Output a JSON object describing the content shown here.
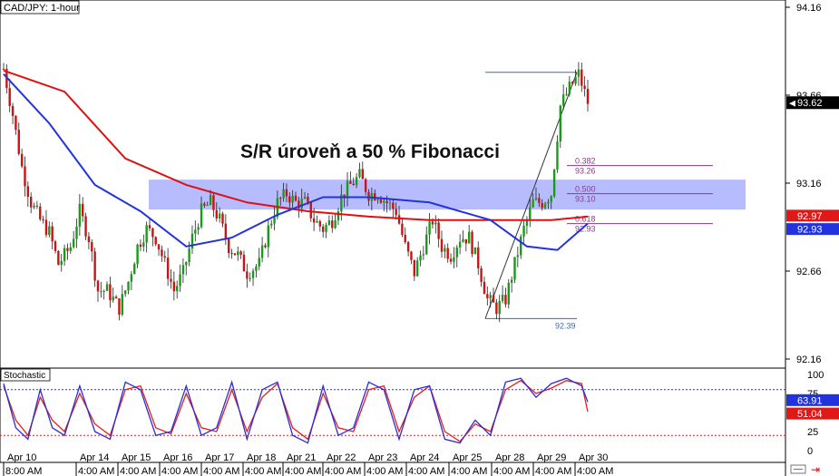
{
  "header": {
    "symbol_label": "CAD/JPY: 1-hour"
  },
  "annotation": {
    "headline": "S/R úroveň a 50 % Fibonacci"
  },
  "price_panel": {
    "y_ticks": [
      "94.16",
      "93.66",
      "93.16",
      "92.66",
      "92.16"
    ],
    "current_price": "93.62",
    "ma_red_value": "92.97",
    "ma_blue_value": "92.93"
  },
  "fibonacci": {
    "high_label": "",
    "low_label": "92.39",
    "levels": [
      {
        "ratio": "0.382",
        "price": "93.26"
      },
      {
        "ratio": "0.500",
        "price": "93.10"
      },
      {
        "ratio": "0.618",
        "price": "92.93"
      }
    ]
  },
  "stochastic": {
    "label": "Stochastic",
    "y_ticks": [
      "100",
      "75",
      "50",
      "25",
      "0"
    ],
    "k_value": "63.91",
    "d_value": "51.04"
  },
  "x_axis": {
    "day_labels": [
      "Apr 10",
      "Apr 14",
      "Apr 15",
      "Apr 16",
      "Apr 17",
      "Apr 18",
      "Apr 21",
      "Apr 22",
      "Apr 23",
      "Apr 24",
      "Apr 25",
      "Apr 28",
      "Apr 29",
      "Apr 30"
    ],
    "time_labels": [
      "8:00 AM",
      "4:00 AM",
      "4:00 AM",
      "4:00 AM",
      "4:00 AM",
      "4:00 AM",
      "4:00 AM",
      "4:00 AM",
      "4:00 AM",
      "4:00 AM",
      "4:00 AM",
      "4:00 AM",
      "4:00 AM",
      "4:00 AM"
    ]
  },
  "colors": {
    "up_candle": "#1a9a1a",
    "down_candle": "#c81414",
    "ma_red": "#dd1111",
    "ma_blue": "#2233dd",
    "sr_zone": "#aab0ff",
    "fib_line": "#8a3a8a",
    "stoch_k": "#2b2bd8",
    "stoch_d": "#e02020"
  },
  "chart_data": {
    "type": "candlestick",
    "title": "CAD/JPY: 1-hour",
    "ylim": [
      92.06,
      94.22
    ],
    "y_ticks": [
      94.16,
      93.66,
      93.16,
      92.66,
      92.16
    ],
    "sr_zone": [
      93.01,
      93.18
    ],
    "fib_retracement": {
      "high": 93.79,
      "low": 92.39,
      "levels": {
        "0.382": 93.26,
        "0.500": 93.1,
        "0.618": 92.93
      }
    },
    "close_path": [
      {
        "x": 0,
        "y": 93.81
      },
      {
        "x": 3,
        "y": 93.55
      },
      {
        "x": 6,
        "y": 93.25
      },
      {
        "x": 9,
        "y": 93.05
      },
      {
        "x": 12,
        "y": 92.95
      },
      {
        "x": 15,
        "y": 92.88
      },
      {
        "x": 18,
        "y": 92.7
      },
      {
        "x": 22,
        "y": 92.8
      },
      {
        "x": 25,
        "y": 93.0
      },
      {
        "x": 28,
        "y": 92.85
      },
      {
        "x": 31,
        "y": 92.55
      },
      {
        "x": 34,
        "y": 92.55
      },
      {
        "x": 38,
        "y": 92.45
      },
      {
        "x": 41,
        "y": 92.6
      },
      {
        "x": 44,
        "y": 92.8
      },
      {
        "x": 47,
        "y": 92.9
      },
      {
        "x": 50,
        "y": 92.85
      },
      {
        "x": 53,
        "y": 92.7
      },
      {
        "x": 56,
        "y": 92.55
      },
      {
        "x": 59,
        "y": 92.65
      },
      {
        "x": 62,
        "y": 92.85
      },
      {
        "x": 65,
        "y": 93.0
      },
      {
        "x": 68,
        "y": 93.05
      },
      {
        "x": 71,
        "y": 92.95
      },
      {
        "x": 74,
        "y": 92.8
      },
      {
        "x": 77,
        "y": 92.75
      },
      {
        "x": 80,
        "y": 92.65
      },
      {
        "x": 84,
        "y": 92.7
      },
      {
        "x": 87,
        "y": 92.9
      },
      {
        "x": 90,
        "y": 93.05
      },
      {
        "x": 93,
        "y": 93.1
      },
      {
        "x": 96,
        "y": 93.05
      },
      {
        "x": 99,
        "y": 93.05
      },
      {
        "x": 102,
        "y": 92.95
      },
      {
        "x": 105,
        "y": 92.9
      },
      {
        "x": 108,
        "y": 92.95
      },
      {
        "x": 111,
        "y": 93.08
      },
      {
        "x": 114,
        "y": 93.15
      },
      {
        "x": 117,
        "y": 93.2
      },
      {
        "x": 120,
        "y": 93.1
      },
      {
        "x": 123,
        "y": 93.1
      },
      {
        "x": 126,
        "y": 93.05
      },
      {
        "x": 129,
        "y": 93.0
      },
      {
        "x": 132,
        "y": 92.8
      },
      {
        "x": 135,
        "y": 92.65
      },
      {
        "x": 138,
        "y": 92.8
      },
      {
        "x": 141,
        "y": 92.95
      },
      {
        "x": 144,
        "y": 92.8
      },
      {
        "x": 147,
        "y": 92.75
      },
      {
        "x": 150,
        "y": 92.85
      },
      {
        "x": 153,
        "y": 92.85
      },
      {
        "x": 156,
        "y": 92.7
      },
      {
        "x": 159,
        "y": 92.5
      },
      {
        "x": 162,
        "y": 92.45
      },
      {
        "x": 165,
        "y": 92.5
      },
      {
        "x": 168,
        "y": 92.7
      },
      {
        "x": 171,
        "y": 92.9
      },
      {
        "x": 174,
        "y": 93.05
      },
      {
        "x": 177,
        "y": 93.05
      },
      {
        "x": 180,
        "y": 93.1
      },
      {
        "x": 183,
        "y": 93.6
      },
      {
        "x": 186,
        "y": 93.7
      },
      {
        "x": 189,
        "y": 93.78
      },
      {
        "x": 192,
        "y": 93.62
      }
    ],
    "ma_red": [
      {
        "x": 0,
        "y": 93.8
      },
      {
        "x": 20,
        "y": 93.68
      },
      {
        "x": 40,
        "y": 93.3
      },
      {
        "x": 60,
        "y": 93.15
      },
      {
        "x": 80,
        "y": 93.05
      },
      {
        "x": 100,
        "y": 93.0
      },
      {
        "x": 120,
        "y": 92.97
      },
      {
        "x": 140,
        "y": 92.95
      },
      {
        "x": 160,
        "y": 92.95
      },
      {
        "x": 180,
        "y": 92.95
      },
      {
        "x": 192,
        "y": 92.97
      }
    ],
    "ma_blue": [
      {
        "x": 0,
        "y": 93.78
      },
      {
        "x": 15,
        "y": 93.5
      },
      {
        "x": 30,
        "y": 93.15
      },
      {
        "x": 45,
        "y": 93.0
      },
      {
        "x": 60,
        "y": 92.8
      },
      {
        "x": 75,
        "y": 92.85
      },
      {
        "x": 90,
        "y": 92.98
      },
      {
        "x": 105,
        "y": 93.08
      },
      {
        "x": 120,
        "y": 93.08
      },
      {
        "x": 140,
        "y": 93.05
      },
      {
        "x": 160,
        "y": 92.95
      },
      {
        "x": 172,
        "y": 92.8
      },
      {
        "x": 182,
        "y": 92.78
      },
      {
        "x": 192,
        "y": 92.93
      }
    ],
    "stochastic_k": [
      {
        "x": 0,
        "y": 88
      },
      {
        "x": 4,
        "y": 30
      },
      {
        "x": 8,
        "y": 15
      },
      {
        "x": 12,
        "y": 80
      },
      {
        "x": 16,
        "y": 30
      },
      {
        "x": 20,
        "y": 20
      },
      {
        "x": 25,
        "y": 85
      },
      {
        "x": 30,
        "y": 25
      },
      {
        "x": 35,
        "y": 15
      },
      {
        "x": 40,
        "y": 90
      },
      {
        "x": 45,
        "y": 80
      },
      {
        "x": 50,
        "y": 20
      },
      {
        "x": 55,
        "y": 25
      },
      {
        "x": 60,
        "y": 85
      },
      {
        "x": 65,
        "y": 20
      },
      {
        "x": 70,
        "y": 30
      },
      {
        "x": 75,
        "y": 90
      },
      {
        "x": 80,
        "y": 15
      },
      {
        "x": 85,
        "y": 80
      },
      {
        "x": 90,
        "y": 90
      },
      {
        "x": 95,
        "y": 20
      },
      {
        "x": 100,
        "y": 10
      },
      {
        "x": 105,
        "y": 85
      },
      {
        "x": 110,
        "y": 20
      },
      {
        "x": 115,
        "y": 30
      },
      {
        "x": 120,
        "y": 90
      },
      {
        "x": 125,
        "y": 80
      },
      {
        "x": 130,
        "y": 15
      },
      {
        "x": 135,
        "y": 80
      },
      {
        "x": 140,
        "y": 85
      },
      {
        "x": 145,
        "y": 15
      },
      {
        "x": 150,
        "y": 10
      },
      {
        "x": 155,
        "y": 40
      },
      {
        "x": 160,
        "y": 20
      },
      {
        "x": 165,
        "y": 90
      },
      {
        "x": 170,
        "y": 95
      },
      {
        "x": 175,
        "y": 70
      },
      {
        "x": 180,
        "y": 88
      },
      {
        "x": 185,
        "y": 95
      },
      {
        "x": 190,
        "y": 85
      },
      {
        "x": 192,
        "y": 63.91
      }
    ],
    "stochastic_d": [
      {
        "x": 0,
        "y": 85
      },
      {
        "x": 4,
        "y": 40
      },
      {
        "x": 8,
        "y": 20
      },
      {
        "x": 12,
        "y": 70
      },
      {
        "x": 16,
        "y": 40
      },
      {
        "x": 20,
        "y": 25
      },
      {
        "x": 25,
        "y": 75
      },
      {
        "x": 30,
        "y": 35
      },
      {
        "x": 35,
        "y": 20
      },
      {
        "x": 40,
        "y": 80
      },
      {
        "x": 45,
        "y": 85
      },
      {
        "x": 50,
        "y": 30
      },
      {
        "x": 55,
        "y": 22
      },
      {
        "x": 60,
        "y": 75
      },
      {
        "x": 65,
        "y": 30
      },
      {
        "x": 70,
        "y": 25
      },
      {
        "x": 75,
        "y": 80
      },
      {
        "x": 80,
        "y": 25
      },
      {
        "x": 85,
        "y": 70
      },
      {
        "x": 90,
        "y": 88
      },
      {
        "x": 95,
        "y": 30
      },
      {
        "x": 100,
        "y": 15
      },
      {
        "x": 105,
        "y": 75
      },
      {
        "x": 110,
        "y": 30
      },
      {
        "x": 115,
        "y": 25
      },
      {
        "x": 120,
        "y": 80
      },
      {
        "x": 125,
        "y": 85
      },
      {
        "x": 130,
        "y": 25
      },
      {
        "x": 135,
        "y": 70
      },
      {
        "x": 140,
        "y": 85
      },
      {
        "x": 145,
        "y": 25
      },
      {
        "x": 150,
        "y": 12
      },
      {
        "x": 155,
        "y": 35
      },
      {
        "x": 160,
        "y": 25
      },
      {
        "x": 165,
        "y": 80
      },
      {
        "x": 170,
        "y": 92
      },
      {
        "x": 175,
        "y": 75
      },
      {
        "x": 180,
        "y": 82
      },
      {
        "x": 185,
        "y": 92
      },
      {
        "x": 190,
        "y": 88
      },
      {
        "x": 192,
        "y": 51.04
      }
    ],
    "stochastic_levels": [
      80,
      20
    ],
    "legend": "none",
    "grid": false
  }
}
